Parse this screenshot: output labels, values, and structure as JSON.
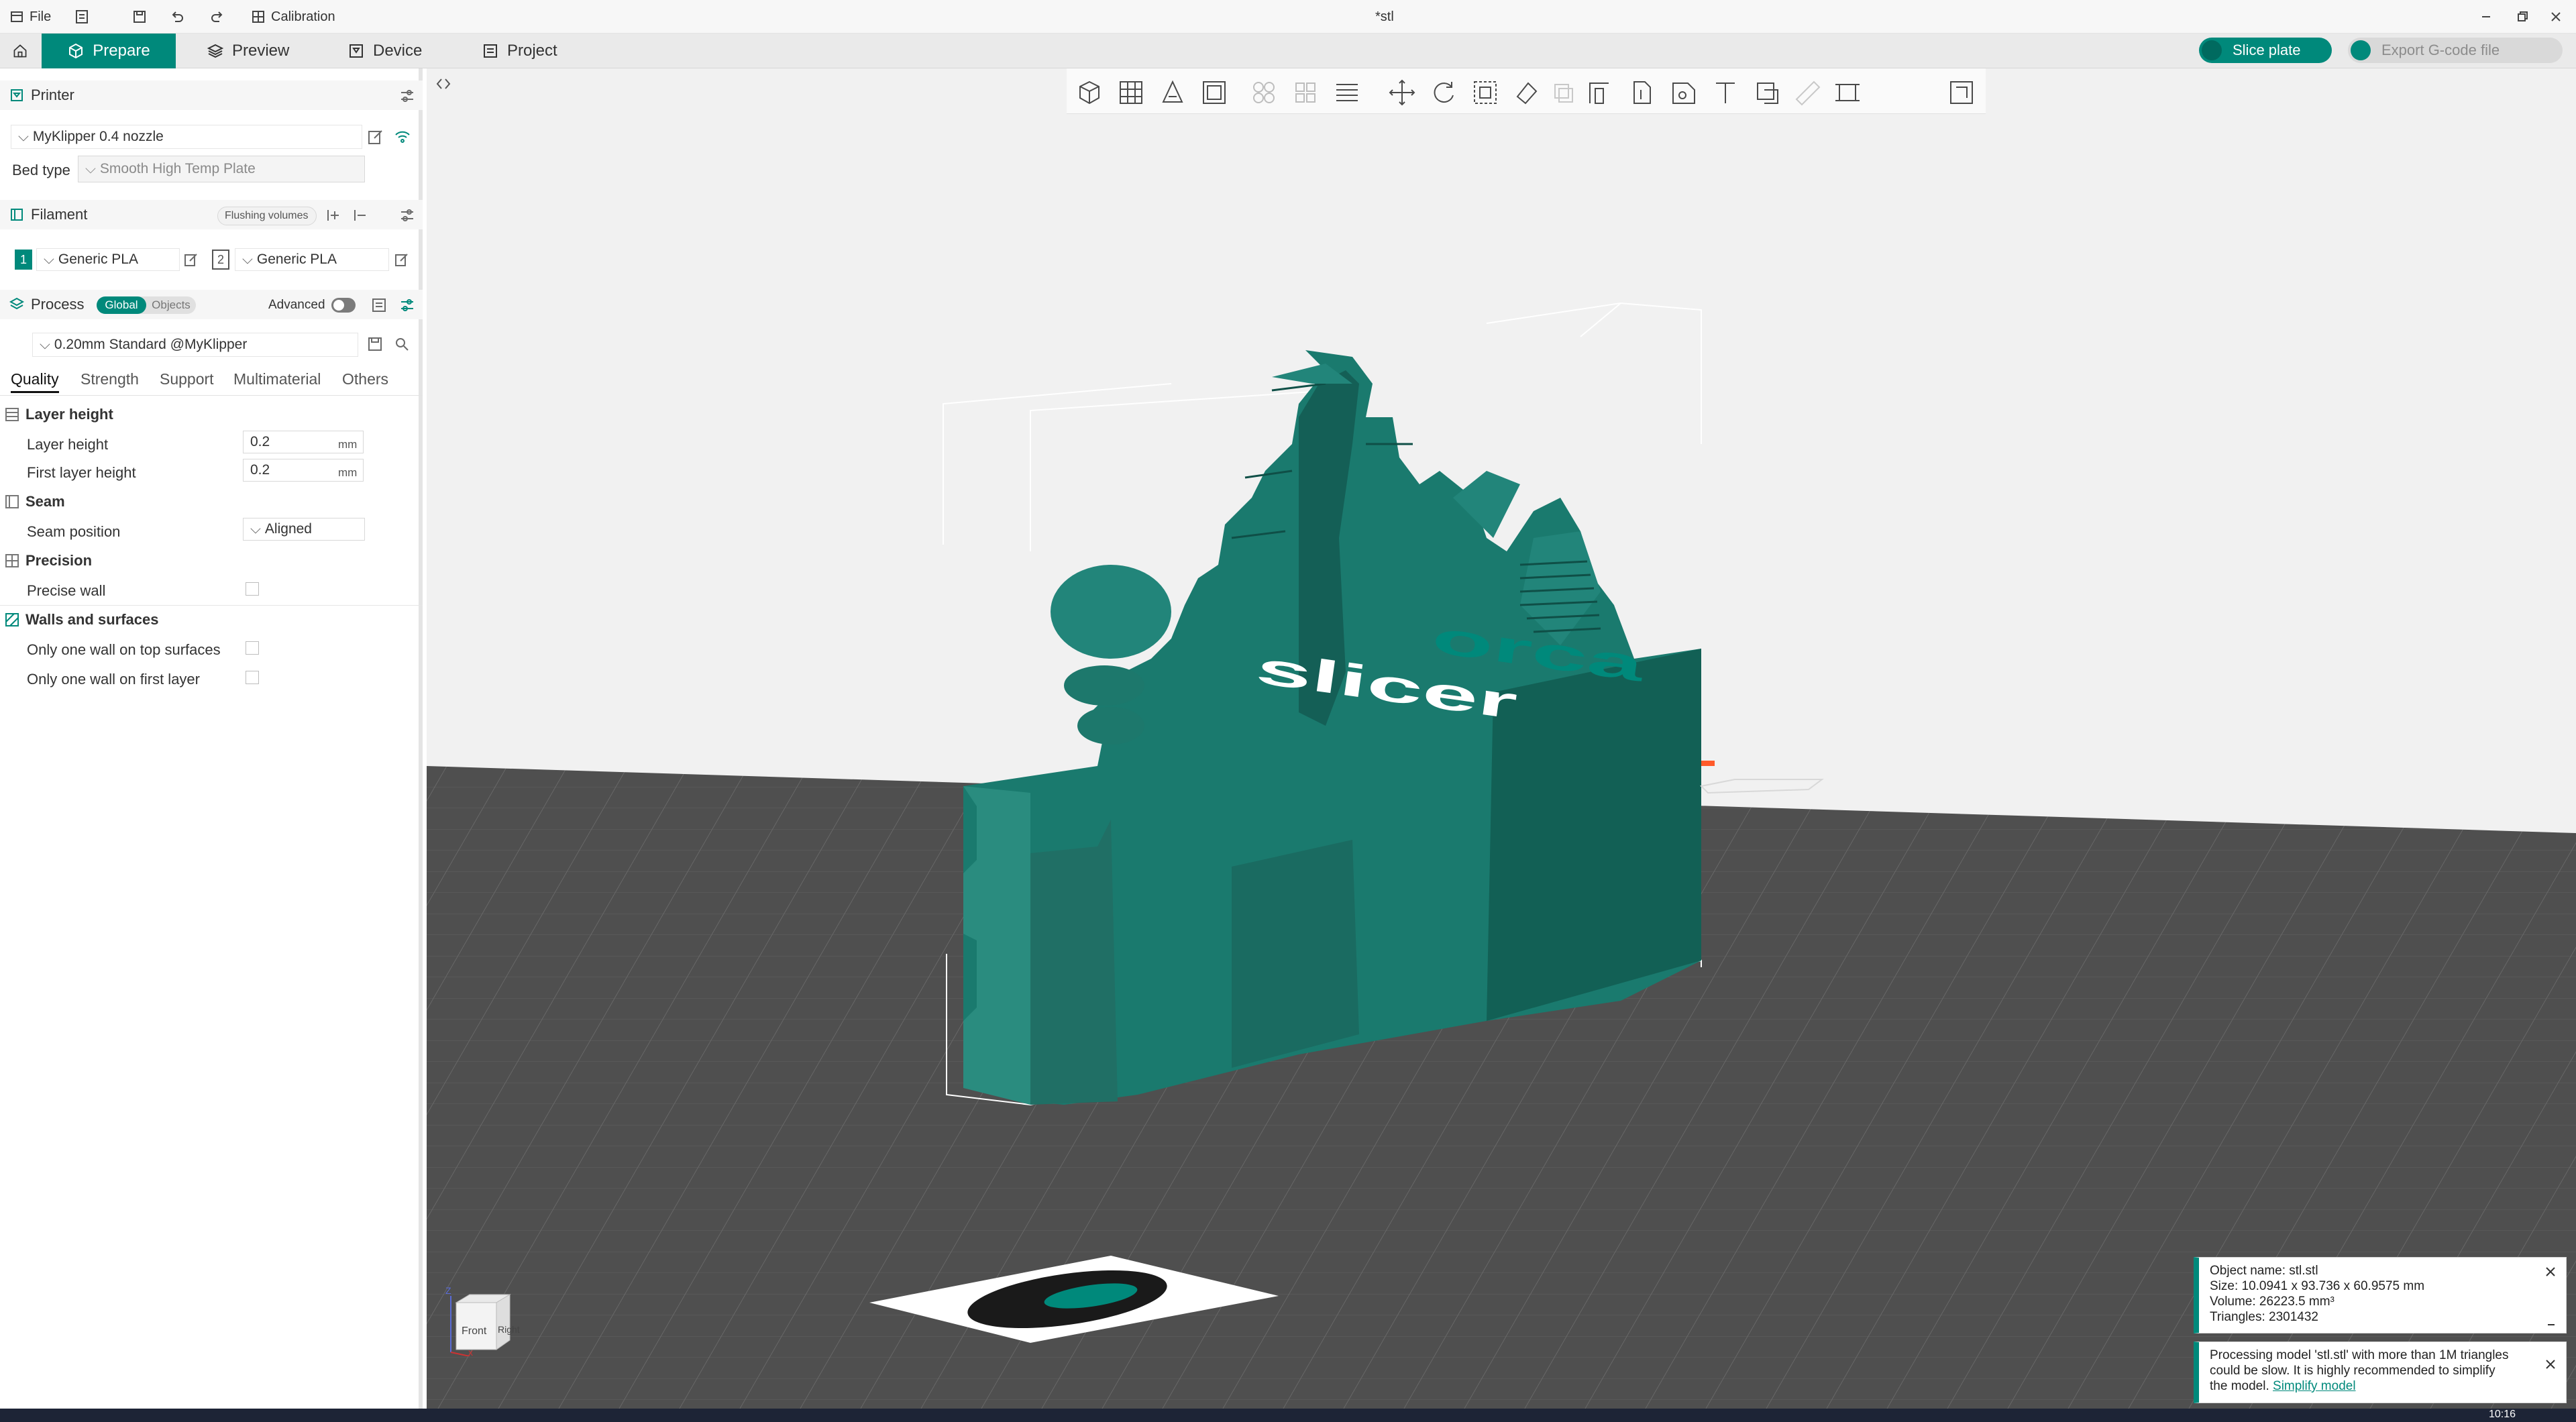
{
  "titlebar": {
    "file_label": "File",
    "calibration_label": "Calibration",
    "document_title": "*stl"
  },
  "tabs": {
    "prepare": "Prepare",
    "preview": "Preview",
    "device": "Device",
    "project": "Project"
  },
  "actions": {
    "slice_plate": "Slice plate",
    "export_gcode": "Export G-code file"
  },
  "printer": {
    "section": "Printer",
    "name": "MyKlipper 0.4 nozzle",
    "bed_type_label": "Bed type",
    "bed_type_value": "Smooth High Temp Plate"
  },
  "filament": {
    "section": "Filament",
    "flushing_button": "Flushing volumes",
    "slot1_num": "1",
    "slot1_name": "Generic PLA",
    "slot2_num": "2",
    "slot2_name": "Generic PLA"
  },
  "process": {
    "section": "Process",
    "toggle_global": "Global",
    "toggle_objects": "Objects",
    "advanced_label": "Advanced",
    "preset": "0.20mm Standard @MyKlipper"
  },
  "subtabs": {
    "quality": "Quality",
    "strength": "Strength",
    "support": "Support",
    "multimaterial": "Multimaterial",
    "others": "Others"
  },
  "settings": {
    "layer_height_group": "Layer height",
    "layer_height_label": "Layer height",
    "layer_height_value": "0.2",
    "layer_height_unit": "mm",
    "first_layer_label": "First layer height",
    "first_layer_value": "0.2",
    "first_layer_unit": "mm",
    "seam_group": "Seam",
    "seam_position_label": "Seam position",
    "seam_position_value": "Aligned",
    "precision_group": "Precision",
    "precise_wall_label": "Precise wall",
    "walls_group": "Walls and surfaces",
    "one_wall_top_label": "Only one wall on top surfaces",
    "one_wall_first_label": "Only one wall on first layer"
  },
  "viewcube": {
    "front": "Front",
    "right": "Right",
    "axis_z": "Z",
    "axis_x": "x"
  },
  "bed_logo": {
    "brand_top": "orca",
    "brand_bottom": "slicer"
  },
  "notifications": {
    "info_line1": "Object name: stl.stl",
    "info_line2": "Size: 10.0941 x 93.736 x 60.9575 mm",
    "info_line3": "Volume: 26223.5 mm³",
    "info_line4": "Triangles: 2301432",
    "warn_line1": "Processing model 'stl.stl' with more than 1M triangles",
    "warn_line2": "could be slow. It is highly recommended to simplify",
    "warn_line3": "the model.",
    "warn_link": "Simplify model"
  },
  "taskbar": {
    "clock": "10:16"
  },
  "colors": {
    "accent": "#00897b",
    "model": "#1a7a6e",
    "bed": "#4f4f4f"
  }
}
